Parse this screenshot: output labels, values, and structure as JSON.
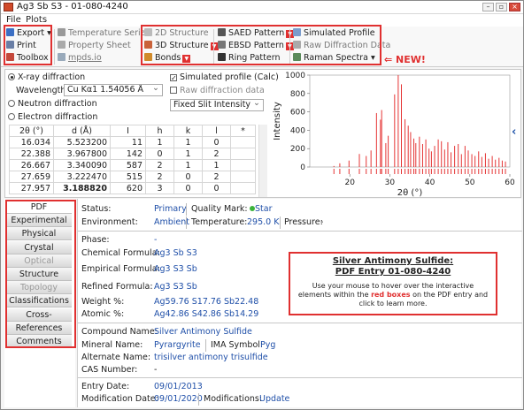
{
  "window": {
    "title": "Ag3 Sb S3 - 01-080-4240"
  },
  "menu": {
    "items": [
      "File",
      "Plots"
    ]
  },
  "toolbar": {
    "export": "Export",
    "print": "Print",
    "toolbox": "Toolbox",
    "temperature_series": "Temperature Series",
    "property_sheet": "Property Sheet",
    "mpds": "mpds.io",
    "structure_2d": "2D Structure",
    "structure_3d": "3D Structure",
    "bonds": "Bonds",
    "saed": "SAED Pattern",
    "ebsd": "EBSD Pattern",
    "ring": "Ring Pattern",
    "simulated_profile": "Simulated Profile",
    "raw_diffraction": "Raw Diffraction Data",
    "raman": "Raman Spectra",
    "new_label": "⇐ NEW!"
  },
  "diffraction": {
    "xray": "X-ray diffraction",
    "wavelength_label": "Wavelength:",
    "wavelength_value": "Cu Kα1 1.54056 Å",
    "neutron": "Neutron diffraction",
    "electron": "Electron diffraction",
    "sim_profile": "Simulated profile (Calc)",
    "raw_data": "Raw diffraction data",
    "slit": "Fixed Slit Intensity"
  },
  "peaks": {
    "headers": [
      "2θ (°)",
      "d (Å)",
      "I",
      "h",
      "k",
      "l",
      "*"
    ],
    "rows": [
      [
        "16.034",
        "5.523200",
        "11",
        "1",
        "1",
        "0",
        ""
      ],
      [
        "22.388",
        "3.967800",
        "142",
        "0",
        "1",
        "2",
        ""
      ],
      [
        "26.667",
        "3.340090",
        "587",
        "2",
        "1",
        "1",
        ""
      ],
      [
        "27.659",
        "3.222470",
        "515",
        "2",
        "0",
        "2",
        ""
      ],
      [
        "27.957",
        "3.188820",
        "620",
        "3",
        "0",
        "0",
        ""
      ]
    ]
  },
  "chart_data": {
    "type": "bar",
    "xlabel": "2θ (°)",
    "ylabel": "Intensity",
    "xlim": [
      10,
      60
    ],
    "ylim": [
      0,
      1000
    ],
    "xticks": [
      20,
      30,
      40,
      50,
      60
    ],
    "yticks": [
      0,
      200,
      400,
      600,
      800,
      1000
    ],
    "color": "#e53535",
    "x": [
      16.03,
      17.5,
      19.8,
      22.39,
      24.1,
      25.3,
      26.67,
      27.66,
      27.96,
      29.0,
      29.6,
      31.2,
      32.1,
      32.9,
      33.8,
      34.6,
      35.2,
      36.0,
      36.5,
      37.4,
      38.2,
      39.0,
      39.8,
      40.4,
      41.2,
      42.1,
      42.9,
      43.7,
      44.5,
      45.3,
      46.2,
      47.1,
      47.9,
      48.8,
      49.6,
      50.5,
      51.3,
      52.2,
      53.0,
      53.9,
      54.7,
      55.6,
      56.4,
      57.3,
      58.1,
      58.9
    ],
    "values": [
      11,
      40,
      70,
      142,
      120,
      180,
      587,
      515,
      620,
      260,
      340,
      790,
      1000,
      900,
      520,
      450,
      380,
      310,
      260,
      330,
      250,
      300,
      200,
      170,
      230,
      300,
      280,
      190,
      270,
      160,
      230,
      250,
      140,
      230,
      180,
      140,
      120,
      170,
      110,
      150,
      90,
      120,
      80,
      100,
      70,
      60
    ]
  },
  "nav": {
    "items": [
      {
        "label": "PDF",
        "dim": false
      },
      {
        "label": "Experimental",
        "dim": false
      },
      {
        "label": "Physical",
        "dim": false
      },
      {
        "label": "Crystal",
        "dim": false
      },
      {
        "label": "Optical",
        "dim": true
      },
      {
        "label": "Structure",
        "dim": false
      },
      {
        "label": "Topology",
        "dim": true
      },
      {
        "label": "Classifications",
        "dim": false
      },
      {
        "label": "Cross-references",
        "dim": false
      },
      {
        "label": "References",
        "dim": false
      },
      {
        "label": "Comments",
        "dim": false
      }
    ]
  },
  "details": {
    "status_label": "Status:",
    "status": "Primary",
    "quality_label": "Quality Mark:",
    "quality": "Star",
    "environment_label": "Environment:",
    "environment": "Ambient",
    "temperature_label": "Temperature:",
    "temperature": "295.0 K",
    "pressure_label": "Pressure:",
    "pressure": "-",
    "phase_label": "Phase:",
    "phase": "-",
    "chem_label": "Chemical Formula:",
    "chem": "Ag3 Sb S3",
    "emp_label": "Empirical Formula:",
    "emp": "Ag3 S3 Sb",
    "ref_label": "Refined Formula:",
    "ref": "Ag3 S3 Sb",
    "weight_label": "Weight %:",
    "weight": "Ag59.76 S17.76 Sb22.48",
    "atomic_label": "Atomic %:",
    "atomic": "Ag42.86 S42.86 Sb14.29",
    "compound_label": "Compound Name:",
    "compound": "Silver Antimony Sulfide",
    "mineral_label": "Mineral Name:",
    "mineral": "Pyrargyrite",
    "ima_label": "IMA Symbol:",
    "ima": "Pyg",
    "alt_label": "Alternate Name:",
    "alt": "trisilver antimony trisulfide",
    "cas_label": "CAS Number:",
    "cas": "-",
    "entry_label": "Entry Date:",
    "entry": "09/01/2013",
    "mod_label": "Modification Date:",
    "mod": "09/01/2020",
    "mods_label": "Modifications:",
    "mods": "Update"
  },
  "infobox": {
    "title1": "Silver Antimony Sulfide:",
    "title2": "PDF Entry 01-080-4240",
    "text1": "Use your mouse to hover over the interactive elements within the",
    "text_red": "red boxes",
    "text2": "on the PDF entry and click to learn more."
  }
}
